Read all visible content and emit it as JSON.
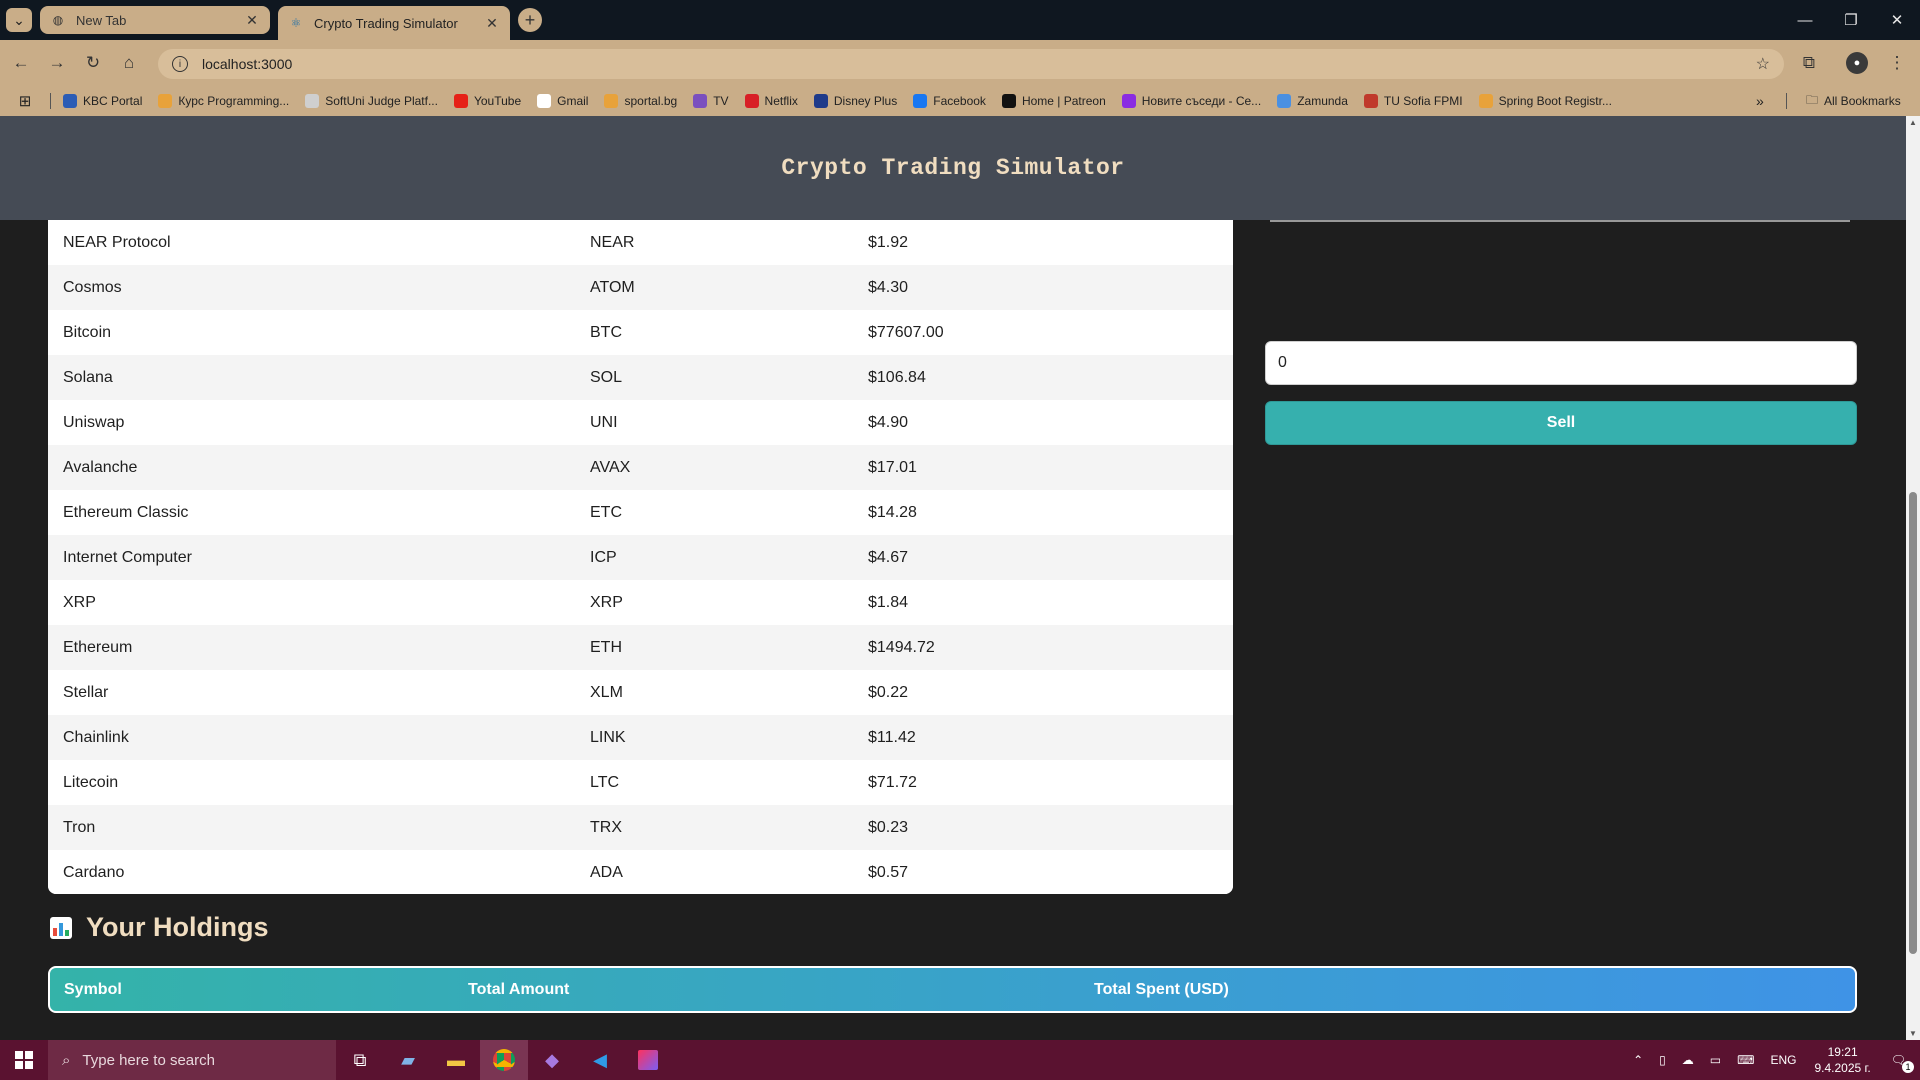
{
  "browser": {
    "tabs": [
      {
        "title": "New Tab",
        "active": false
      },
      {
        "title": "Crypto Trading Simulator",
        "active": true
      }
    ],
    "url": "localhost:3000",
    "bookmarks": [
      {
        "label": "KBC Portal",
        "icon": "kbc-icon",
        "color": "#2b5cb5"
      },
      {
        "label": "Курс Programming...",
        "icon": "softuni-icon",
        "color": "#e8a23a"
      },
      {
        "label": "SoftUni Judge Platf...",
        "icon": "page-icon",
        "color": "#cfcfcf"
      },
      {
        "label": "YouTube",
        "icon": "youtube-icon",
        "color": "#e62117"
      },
      {
        "label": "Gmail",
        "icon": "google-icon",
        "color": "#ffffff"
      },
      {
        "label": "sportal.bg",
        "icon": "sportal-icon",
        "color": "#e8a23a"
      },
      {
        "label": "TV",
        "icon": "tv-icon",
        "color": "#7a4fbf"
      },
      {
        "label": "Netflix",
        "icon": "netflix-icon",
        "color": "#d81f26"
      },
      {
        "label": "Disney Plus",
        "icon": "disney-icon",
        "color": "#1e3a8a"
      },
      {
        "label": "Facebook",
        "icon": "facebook-icon",
        "color": "#1877f2"
      },
      {
        "label": "Home | Patreon",
        "icon": "patreon-icon",
        "color": "#111111"
      },
      {
        "label": "Новите съседи - Се...",
        "icon": "play-icon",
        "color": "#8a2be2"
      },
      {
        "label": "Zamunda",
        "icon": "zamunda-icon",
        "color": "#4a90e2"
      },
      {
        "label": "TU Sofia FPMI",
        "icon": "tu-icon",
        "color": "#c0392b"
      },
      {
        "label": "Spring Boot Registr...",
        "icon": "spring-icon",
        "color": "#e8a23a"
      }
    ],
    "all_bookmarks_label": "All Bookmarks"
  },
  "app": {
    "title": "Crypto Trading Simulator",
    "cryptos": [
      {
        "name": "NEAR Protocol",
        "symbol": "NEAR",
        "price": "$1.92"
      },
      {
        "name": "Cosmos",
        "symbol": "ATOM",
        "price": "$4.30"
      },
      {
        "name": "Bitcoin",
        "symbol": "BTC",
        "price": "$77607.00"
      },
      {
        "name": "Solana",
        "symbol": "SOL",
        "price": "$106.84"
      },
      {
        "name": "Uniswap",
        "symbol": "UNI",
        "price": "$4.90"
      },
      {
        "name": "Avalanche",
        "symbol": "AVAX",
        "price": "$17.01"
      },
      {
        "name": "Ethereum Classic",
        "symbol": "ETC",
        "price": "$14.28"
      },
      {
        "name": "Internet Computer",
        "symbol": "ICP",
        "price": "$4.67"
      },
      {
        "name": "XRP",
        "symbol": "XRP",
        "price": "$1.84"
      },
      {
        "name": "Ethereum",
        "symbol": "ETH",
        "price": "$1494.72"
      },
      {
        "name": "Stellar",
        "symbol": "XLM",
        "price": "$0.22"
      },
      {
        "name": "Chainlink",
        "symbol": "LINK",
        "price": "$11.42"
      },
      {
        "name": "Litecoin",
        "symbol": "LTC",
        "price": "$71.72"
      },
      {
        "name": "Tron",
        "symbol": "TRX",
        "price": "$0.23"
      },
      {
        "name": "Cardano",
        "symbol": "ADA",
        "price": "$0.57"
      }
    ],
    "sell_form": {
      "amount_value": "0",
      "sell_label": "Sell"
    },
    "holdings": {
      "title": "Your Holdings",
      "columns": [
        "Symbol",
        "Total Amount",
        "Total Spent (USD)"
      ]
    }
  },
  "taskbar": {
    "search_placeholder": "Type here to search",
    "language": "ENG",
    "time": "19:21",
    "date": "9.4.2025 г.",
    "notification_count": "1"
  },
  "colors": {
    "header_bg": "#454b55",
    "title_color": "#f0ddc0",
    "sell_button": "#36b0ae",
    "holdings_gradient_start": "#34b3a9",
    "holdings_gradient_end": "#3f93e6",
    "taskbar": "#5a1230"
  }
}
